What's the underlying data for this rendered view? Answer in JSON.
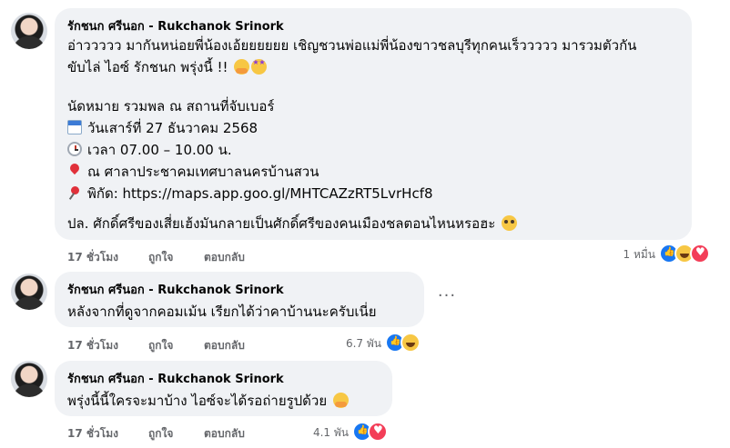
{
  "comments": [
    {
      "author": "รักชนก ศรีนอก - Rukchanok Srinork",
      "line1": "อ่าววววว มากันหน่อยพี่น้องเอ้ยยยยยย เชิญชวนพ่อแม่พี่น้องขาวชลบุรีทุกคนเร็ววววว มารวมตัวกัน",
      "line2": "ขับไล่ ไอซ์ รักชนก พรุ่งนี้ !!",
      "line3": "นัดหมาย รวมพล ณ สถานที่จับเบอร์",
      "date": "วันเสาร์ที่ 27 ธันวาคม 2568",
      "time": "เวลา 07.00 – 10.00 น.",
      "place": "ณ ศาลาประชาคมเทศบาลนครบ้านสวน",
      "map_label": "พิกัด: ",
      "map_link": "https://maps.app.goo.gl/MHTCAZzRT5LvrHcf8",
      "ps": "ปล. ศักดิ์ศรีของเสี่ยเฮ้งมันกลายเป็นศักดิ์ศรีของคนเมืองชลตอนไหนหรอฮะ",
      "time_ago": "17 ชั่วโมง",
      "like": "ถูกใจ",
      "reply": "ตอบกลับ",
      "reaction_count": "1 หมื่น"
    },
    {
      "author": "รักชนก ศรีนอก - Rukchanok Srinork",
      "text": "หลังจากที่ดูจากคอมเม้น เรียกได้ว่าคาบ้านนะครับเนี่ย",
      "time_ago": "17 ชั่วโมง",
      "like": "ถูกใจ",
      "reply": "ตอบกลับ",
      "reaction_count": "6.7 พัน",
      "more": "···"
    },
    {
      "author": "รักชนก ศรีนอก - Rukchanok Srinork",
      "text": "พรุ่งนี้นี้ใครจะมาบ้าง ไอซ์จะได้รอถ่ายรูปด้วย",
      "time_ago": "17 ชั่วโมง",
      "like": "ถูกใจ",
      "reply": "ตอบกลับ",
      "reaction_count": "4.1 พัน"
    }
  ],
  "icons": [
    "calendar-icon",
    "clock-icon",
    "pin-icon",
    "pushpin-icon",
    "like-reaction-icon",
    "haha-reaction-icon",
    "love-reaction-icon"
  ]
}
